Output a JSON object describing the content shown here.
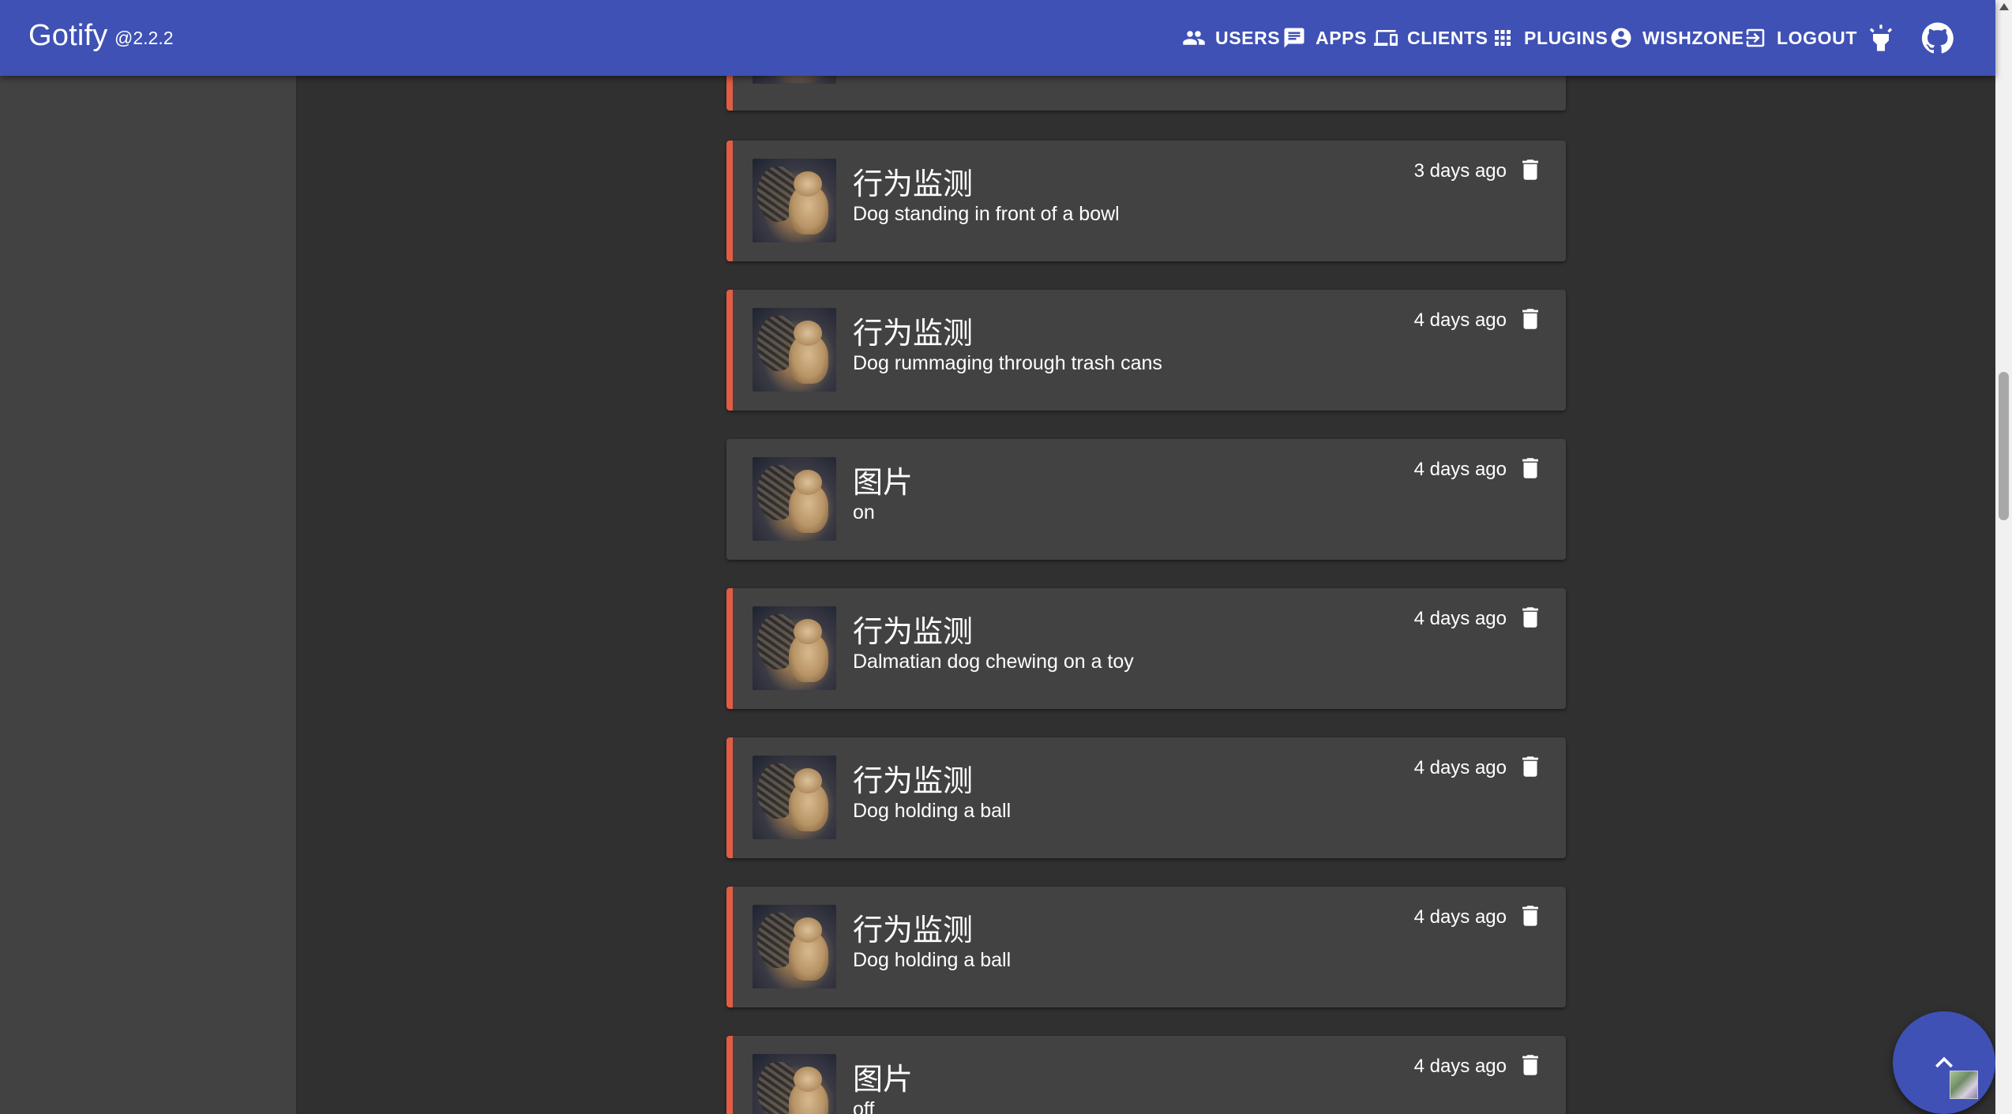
{
  "app": {
    "title": "Gotify",
    "version": "@2.2.2"
  },
  "nav": {
    "users": "USERS",
    "apps": "APPS",
    "clients": "CLIENTS",
    "plugins": "PLUGINS",
    "user": "WISHZONE",
    "logout": "LOGOUT"
  },
  "icons": {
    "users": "people-icon",
    "apps": "chat-icon",
    "clients": "devices-icon",
    "plugins": "apps-grid-icon",
    "user": "account-circle-icon",
    "logout": "exit-icon",
    "theme": "highlight-icon",
    "github": "github-icon",
    "delete": "trash-icon",
    "scroll_top": "chevron-up-icon"
  },
  "colors": {
    "appbar": "#3f51b5",
    "priority_bar": "#e15c43",
    "card": "#424242",
    "background": "#303030"
  },
  "messages": [
    {
      "title": "行为监测",
      "body": "Dog standing in front of a bowl",
      "time": "3 days ago",
      "priority": true
    },
    {
      "title": "行为监测",
      "body": "Dog rummaging through trash cans",
      "time": "4 days ago",
      "priority": true
    },
    {
      "title": "图片",
      "body": "on",
      "time": "4 days ago",
      "priority": false
    },
    {
      "title": "行为监测",
      "body": "Dalmatian dog chewing on a toy",
      "time": "4 days ago",
      "priority": true
    },
    {
      "title": "行为监测",
      "body": "Dog holding a ball",
      "time": "4 days ago",
      "priority": true
    },
    {
      "title": "行为监测",
      "body": "Dog holding a ball",
      "time": "4 days ago",
      "priority": true
    },
    {
      "title": "图片",
      "body": "off",
      "time": "4 days ago",
      "priority": true
    }
  ]
}
